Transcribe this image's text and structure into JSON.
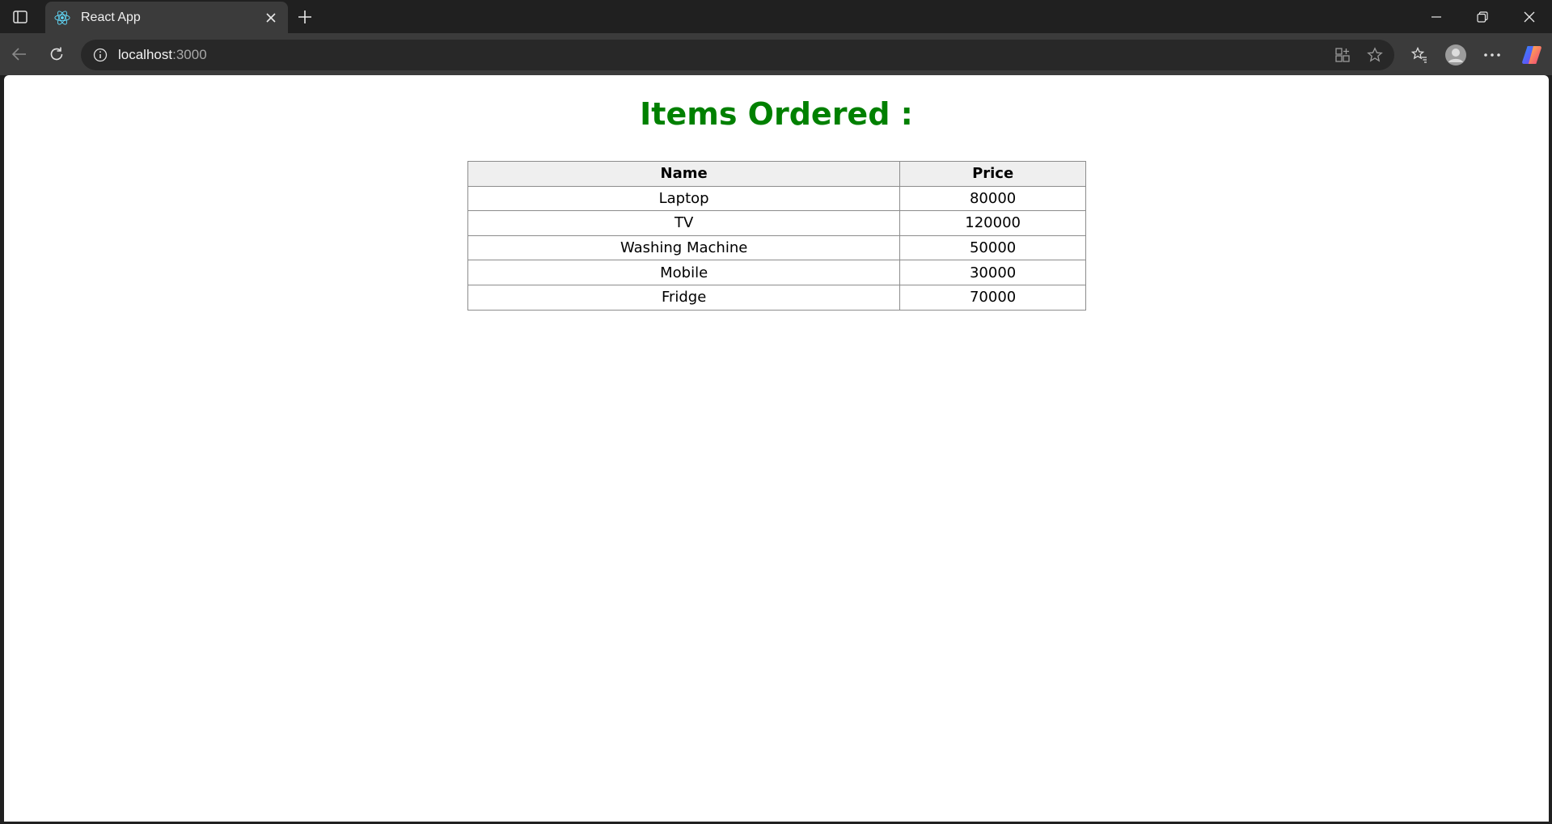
{
  "browser": {
    "tab": {
      "title": "React App",
      "favicon": "react-icon"
    },
    "address": {
      "host": "localhost",
      "port": ":3000"
    }
  },
  "page": {
    "heading": "Items Ordered :",
    "table": {
      "headers": [
        "Name",
        "Price"
      ],
      "rows": [
        [
          "Laptop",
          "80000"
        ],
        [
          "TV",
          "120000"
        ],
        [
          "Washing Machine",
          "50000"
        ],
        [
          "Mobile",
          "30000"
        ],
        [
          "Fridge",
          "70000"
        ]
      ]
    }
  },
  "colors": {
    "heading": "#008000",
    "header_bg": "#efefef",
    "border": "#8c8c8c"
  }
}
